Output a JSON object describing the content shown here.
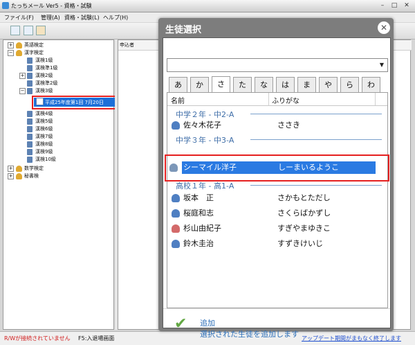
{
  "window": {
    "title": "たっちメール Ver5 - 資格・試験",
    "controls": [
      "–",
      "□",
      "✕"
    ]
  },
  "menu": [
    "ファイル(F)",
    "管理(A)",
    "資格・試験(L)",
    "ヘルプ(H)"
  ],
  "tree": {
    "nodes": [
      {
        "label": "英語検定",
        "expander": "+"
      },
      {
        "label": "漢字検定",
        "expander": "−"
      },
      {
        "label": "漢検1級"
      },
      {
        "label": "漢検準1級"
      },
      {
        "label": "漢検2級",
        "expander": "+"
      },
      {
        "label": "漢検準2級"
      },
      {
        "label": "漢検3級",
        "expander": "−"
      },
      {
        "label": "漢検4級"
      },
      {
        "label": "漢検5級"
      },
      {
        "label": "漢検6級"
      },
      {
        "label": "漢検7級"
      },
      {
        "label": "漢検8級"
      },
      {
        "label": "漢検9級"
      },
      {
        "label": "漢検10級"
      },
      {
        "label": "数学検定",
        "expander": "+"
      },
      {
        "label": "秘書検",
        "expander": "+"
      }
    ],
    "selected_item": "平成25年度第1回 7月20日"
  },
  "right_pane": {
    "header": "申込者"
  },
  "dialog": {
    "title": "生徒選択",
    "close_icon": "✕",
    "combo_value": "",
    "tabs": [
      "あ",
      "か",
      "さ",
      "た",
      "な",
      "は",
      "ま",
      "や",
      "ら",
      "わ"
    ],
    "active_tab": "さ",
    "columns": [
      "名前",
      "ふりがな"
    ],
    "groups": [
      {
        "label": "中学２年 - 中2-A",
        "rows": [
          {
            "name": "佐々木花子",
            "furigana": "ささき",
            "gender": "male"
          }
        ]
      },
      {
        "label": "中学３年 - 中3-A",
        "rows": [
          {
            "name": "シーマイル洋子",
            "furigana": "しーまいるようこ",
            "gender": "neutral",
            "selected": true
          }
        ]
      },
      {
        "label": "高校１年 - 高1-A",
        "rows": [
          {
            "name": "坂本　正",
            "furigana": "さかもとただし",
            "gender": "male"
          },
          {
            "name": "桜庭和志",
            "furigana": "さくらばかずし",
            "gender": "male"
          },
          {
            "name": "杉山由紀子",
            "furigana": "すぎやまゆきこ",
            "gender": "female"
          },
          {
            "name": "鈴木圭治",
            "furigana": "すずきけいじ",
            "gender": "male"
          }
        ]
      }
    ],
    "add": {
      "title": "追加",
      "description": "選択された生徒を追加します"
    }
  },
  "status": {
    "left": "R/Wが接続されていません",
    "f5": "F5:入退場画面",
    "right": "アップデート期間がまもなく終了します"
  },
  "colors": {
    "accent": "#1c6fd8",
    "highlight_box": "#e51f1f",
    "status_warning": "#d11a1a",
    "status_link": "#1f4fcf"
  }
}
